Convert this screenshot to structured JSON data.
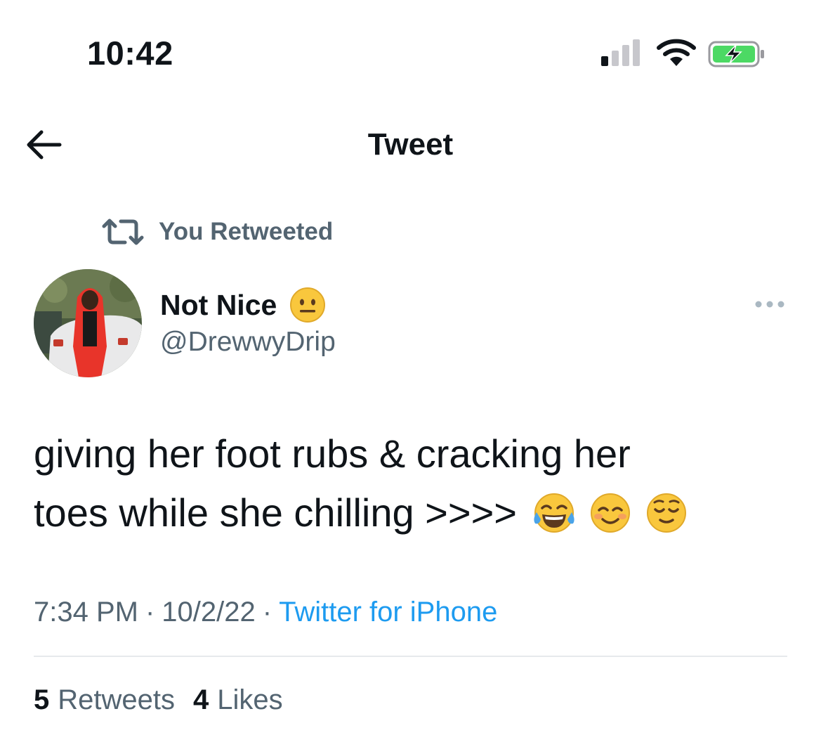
{
  "status_bar": {
    "time": "10:42",
    "icons": [
      "cellular-signal-icon",
      "wifi-icon",
      "battery-charging-icon"
    ],
    "battery_color": "#4cd964"
  },
  "nav": {
    "back_icon": "arrow-left-icon",
    "title": "Tweet"
  },
  "retweet_context": {
    "icon": "retweet-icon",
    "label": "You Retweeted"
  },
  "author": {
    "display_name": "Not Nice",
    "name_emoji": "neutral-face-emoji",
    "handle": "@DrewwyDrip",
    "avatar": "profile-photo-person-in-red-hoodie-by-white-car"
  },
  "more_icon": "more-horizontal-icon",
  "tweet": {
    "text_line_1": "giving her foot rubs & cracking her",
    "text_line_2": "toes while she chilling >>>>",
    "emojis": [
      "tears-of-joy-emoji",
      "smiling-face-emoji",
      "relieved-face-emoji"
    ]
  },
  "meta": {
    "time": "7:34 PM",
    "separator": "·",
    "date": "10/2/22",
    "source": "Twitter for iPhone"
  },
  "stats": {
    "retweets_count": "5",
    "retweets_label": "Retweets",
    "likes_count": "4",
    "likes_label": "Likes"
  },
  "colors": {
    "text_primary": "#0f1419",
    "text_secondary": "#536471",
    "link": "#1d9bf0",
    "divider": "#e6e9ec"
  }
}
